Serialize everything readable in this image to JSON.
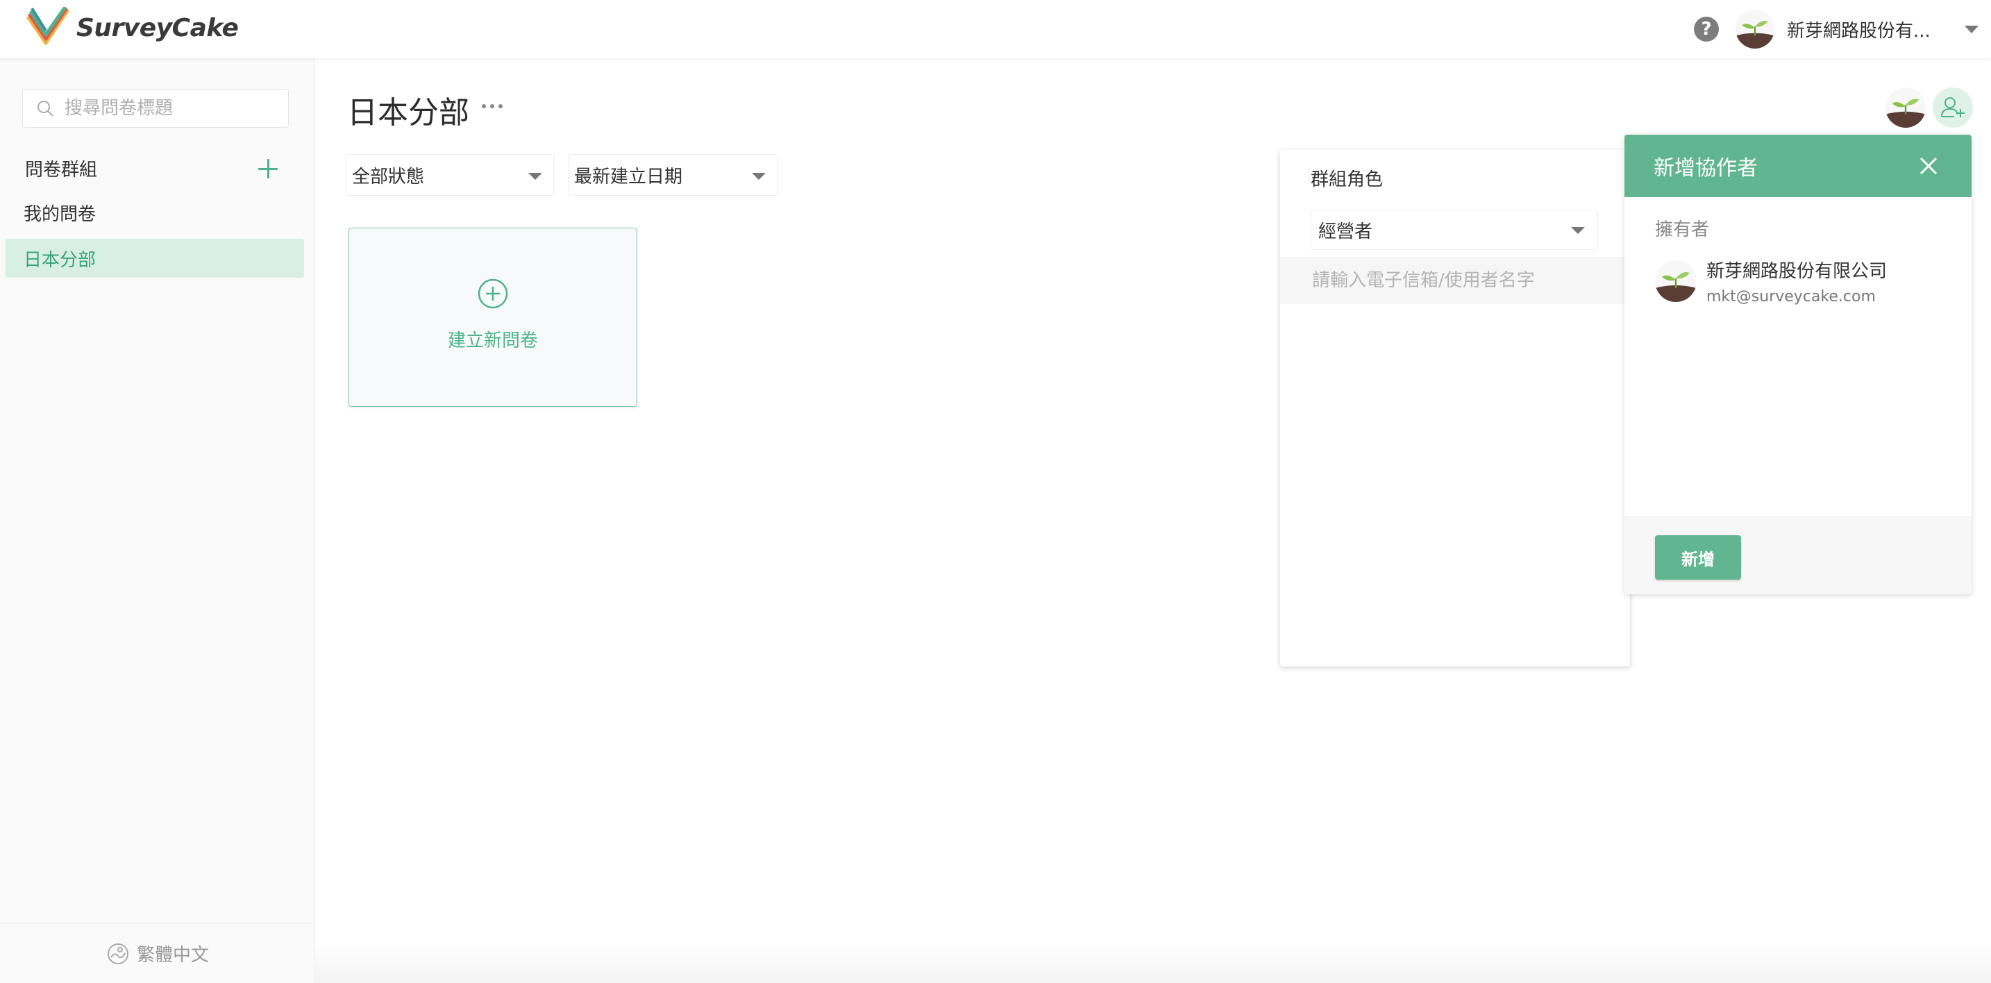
{
  "header": {
    "logo_text": "SurveyCake",
    "help_icon_glyph": "?",
    "account_name": "新芽網路股份有..."
  },
  "sidebar": {
    "search_placeholder": "搜尋問卷標題",
    "group_title": "問卷群組",
    "items": [
      {
        "label": "我的問卷",
        "active": false
      },
      {
        "label": "日本分部",
        "active": true
      }
    ],
    "language": "繁體中文"
  },
  "main": {
    "page_title": "日本分部",
    "status_filter": "全部狀態",
    "sort_filter": "最新建立日期",
    "new_survey_label": "建立新問卷"
  },
  "role_panel": {
    "label": "群組角色",
    "selected_role": "經營者",
    "email_placeholder": "請輸入電子信箱/使用者名字"
  },
  "collab_panel": {
    "title": "新增協作者",
    "owner_label": "擁有者",
    "owner_name": "新芽網路股份有限公司",
    "owner_email": "mkt@surveycake.com",
    "add_button": "新增"
  },
  "colors": {
    "accent": "#62b591",
    "accent_light": "#d9efe4",
    "active_text": "#3aa57a"
  }
}
